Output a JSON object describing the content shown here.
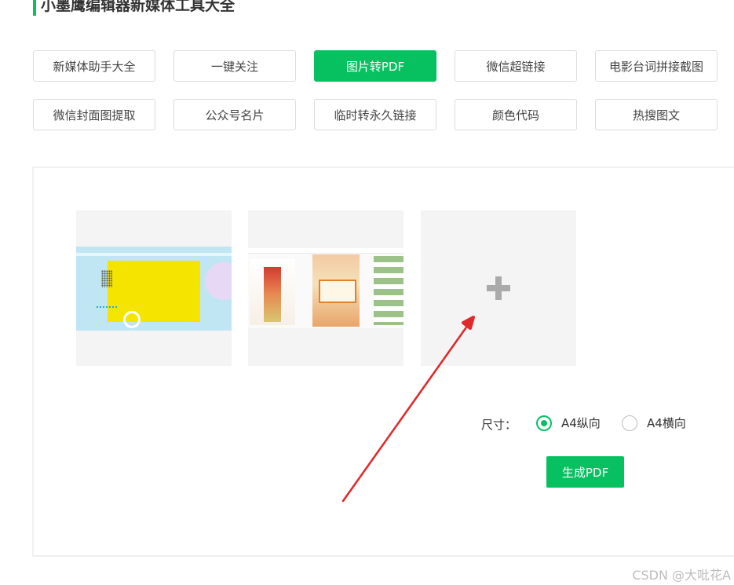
{
  "header": {
    "title": "小墨鹰编辑器新媒体工具大全"
  },
  "tools": [
    {
      "label": "新媒体助手大全",
      "active": false
    },
    {
      "label": "一键关注",
      "active": false
    },
    {
      "label": "图片转PDF",
      "active": true
    },
    {
      "label": "微信超链接",
      "active": false
    },
    {
      "label": "电影台词拼接截图",
      "active": false
    },
    {
      "label": "微信封面图提取",
      "active": false
    },
    {
      "label": "公众号名片",
      "active": false
    },
    {
      "label": "临时转永久链接",
      "active": false
    },
    {
      "label": "颜色代码",
      "active": false
    },
    {
      "label": "热搜图文",
      "active": false
    }
  ],
  "options": {
    "size_label": "尺寸：",
    "portrait_label": "A4纵向",
    "landscape_label": "A4横向",
    "selected": "A4纵向"
  },
  "actions": {
    "generate_label": "生成PDF"
  },
  "watermark": "CSDN @大吡花A",
  "colors": {
    "accent": "#07c160",
    "arrow": "#e02a2a"
  }
}
